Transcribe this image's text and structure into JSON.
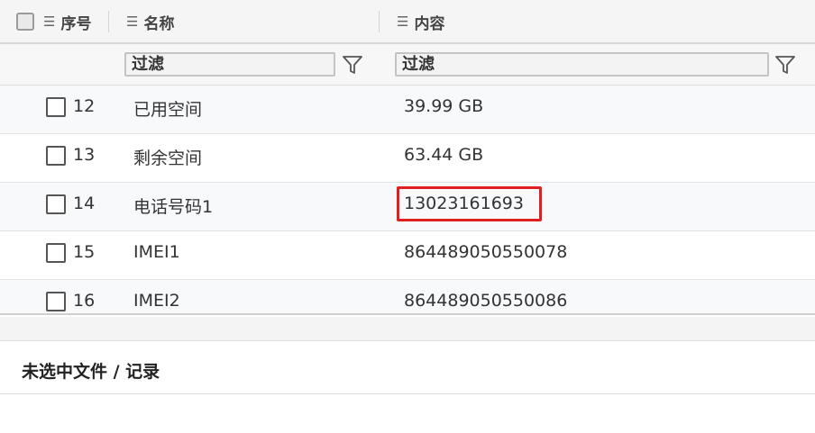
{
  "header": {
    "index_label": "序号",
    "name_label": "名称",
    "content_label": "内容"
  },
  "filters": {
    "name_value": "过滤",
    "content_value": "过滤"
  },
  "rows": [
    {
      "index": "12",
      "name": "已用空间",
      "content": "39.99 GB"
    },
    {
      "index": "13",
      "name": "剩余空间",
      "content": "63.44 GB"
    },
    {
      "index": "14",
      "name": "电话号码1",
      "content": "13023161693"
    },
    {
      "index": "15",
      "name": "IMEI1",
      "content": "864489050550078"
    },
    {
      "index": "16",
      "name": "IMEI2",
      "content": "864489050550086"
    }
  ],
  "footer": {
    "status": "未选中文件 / 记录"
  },
  "colors": {
    "highlight": "#e02020"
  }
}
